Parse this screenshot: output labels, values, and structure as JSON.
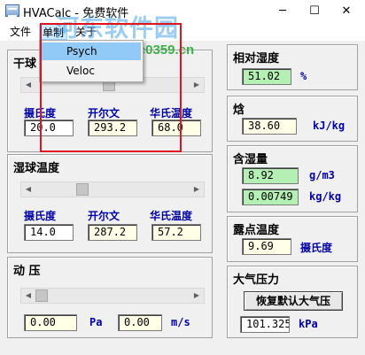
{
  "window": {
    "title": "HVACalc - 免费软件",
    "minimize_icon": "─",
    "maximize_icon": "☐",
    "close_icon": "✕"
  },
  "watermark": {
    "text": "河东软件园",
    "url": "www.pc0359.cn"
  },
  "menu": {
    "file": "文件",
    "unit": "单制",
    "about": "关于",
    "dropdown": [
      "Psych",
      "Veloc"
    ]
  },
  "dry_bulb": {
    "title": "干球",
    "celsius_label": "摄氏度",
    "kelvin_label": "开尔文",
    "fahrenheit_label": "华氏温度",
    "celsius": "20.0",
    "kelvin": "293.2",
    "fahrenheit": "68.0"
  },
  "wet_bulb": {
    "title": "湿球温度",
    "celsius_label": "摄氏度",
    "kelvin_label": "开尔文",
    "fahrenheit_label": "华氏温度",
    "celsius": "14.0",
    "kelvin": "287.2",
    "fahrenheit": "57.2"
  },
  "dynamic_pressure": {
    "title": "动 压",
    "pa_value": "0.00",
    "pa_unit": "Pa",
    "velocity_value": "0.00",
    "velocity_unit": "m/s"
  },
  "relative_humidity": {
    "title": "相对湿度",
    "value": "51.02",
    "unit": "%"
  },
  "enthalpy": {
    "title": "焓",
    "value": "38.60",
    "unit": "kJ/kg"
  },
  "moisture": {
    "title": "含湿量",
    "gm3_value": "8.92",
    "gm3_unit": "g/m3",
    "kgkg_value": "0.00749",
    "kgkg_unit": "kg/kg"
  },
  "dew_point": {
    "title": "露点温度",
    "value": "9.69",
    "unit": "摄氏度"
  },
  "atmospheric": {
    "title": "大气压力",
    "reset_button": "恢复默认大气压",
    "value": "101.325",
    "unit": "kPa"
  },
  "scrollbars": {
    "arrow_left": "◀",
    "arrow_right": "▶",
    "dry_bulb_position": 0.45,
    "wet_bulb_position": 0.3,
    "pressure_position": 0.0
  }
}
